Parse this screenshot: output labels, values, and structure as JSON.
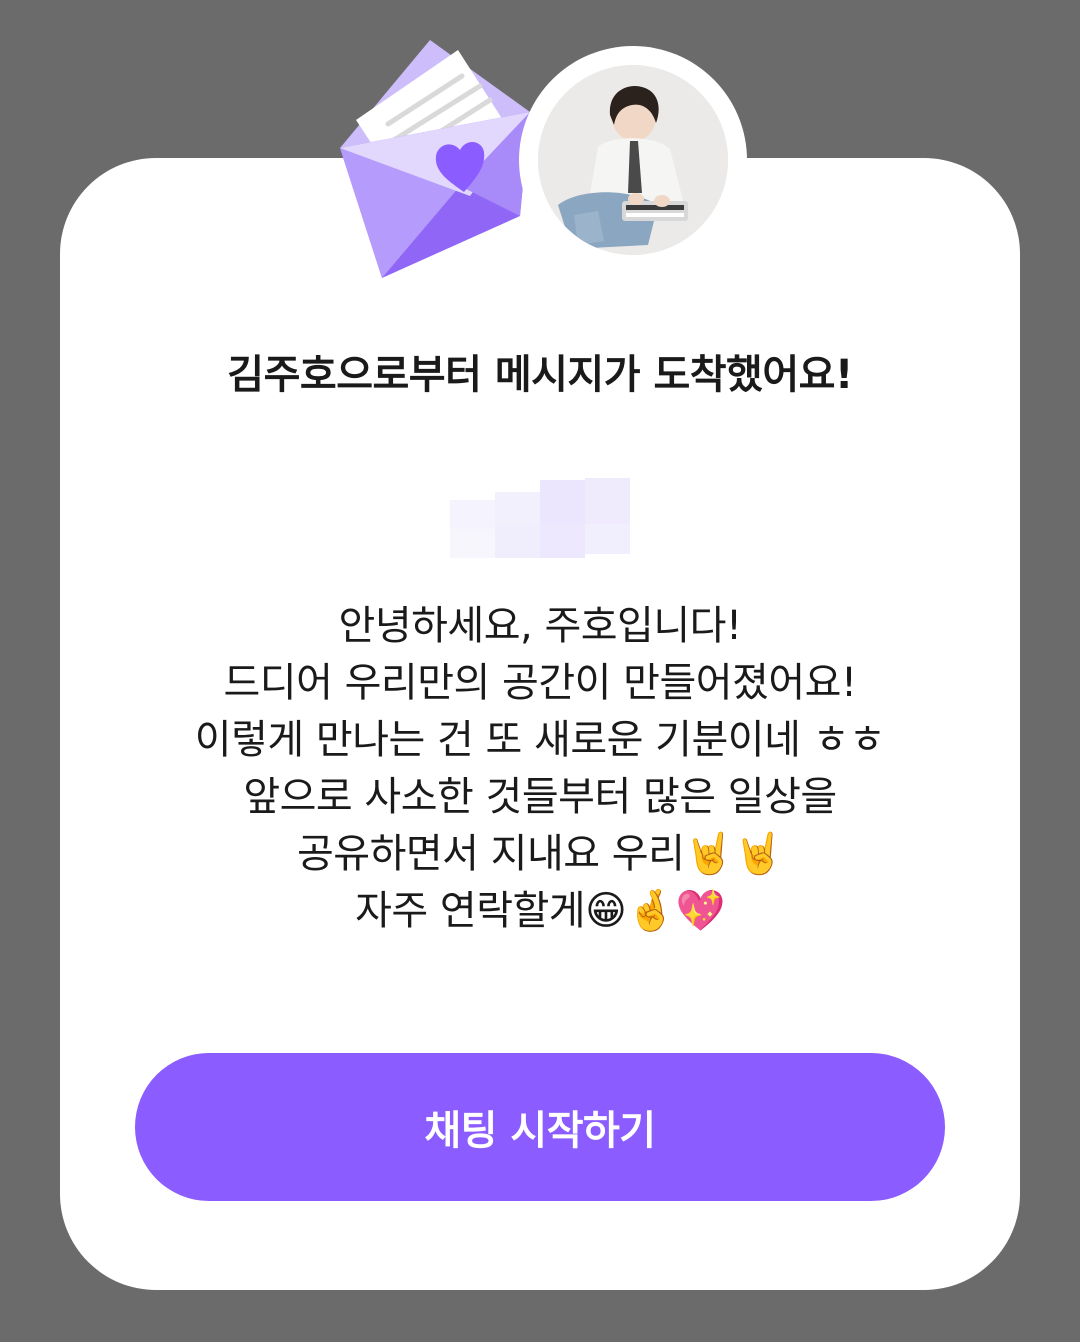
{
  "dialog": {
    "title": "김주호으로부터 메시지가 도착했어요!",
    "message_lines": [
      "안녕하세요, 주호입니다!",
      "드디어 우리만의 공간이 만들어졌어요!",
      "이렇게 만나는 건 또 새로운 기분이네 ㅎㅎ",
      "앞으로 사소한 것들부터 많은 일상을",
      "공유하면서 지내요 우리🤘🤘",
      "자주 연락할게😁🤞💖"
    ],
    "start_chat_label": "채팅 시작하기"
  },
  "icons": {
    "envelope": "envelope-heart-icon",
    "avatar": "sender-avatar"
  },
  "colors": {
    "backdrop": "#6b6b6b",
    "card": "#ffffff",
    "accent": "#8b5cff",
    "envelope_light": "#d9cdfd",
    "envelope_dark": "#8c63f5"
  }
}
